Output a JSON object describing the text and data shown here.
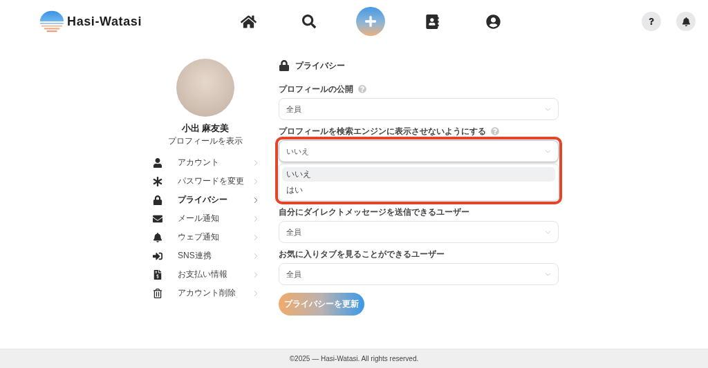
{
  "header": {
    "brand": "Hasi-Watasi"
  },
  "profile": {
    "name": "小出 麻友美",
    "link": "プロフィールを表示"
  },
  "sidebar": {
    "items": [
      {
        "label": "アカウント",
        "selected": false
      },
      {
        "label": "パスワードを変更",
        "selected": false
      },
      {
        "label": "プライバシー",
        "selected": true
      },
      {
        "label": "メール通知",
        "selected": false
      },
      {
        "label": "ウェブ通知",
        "selected": false
      },
      {
        "label": "SNS連携",
        "selected": false
      },
      {
        "label": "お支払い情報",
        "selected": false
      },
      {
        "label": "アカウント削除",
        "selected": false
      }
    ]
  },
  "section": {
    "title": "プライバシー"
  },
  "fields": [
    {
      "label": "プロフィールの公開",
      "help": true,
      "value": "全員",
      "expanded": false,
      "highlighted": false
    },
    {
      "label": "プロフィールを検索エンジンに表示させないようにする",
      "help": true,
      "value": "いいえ",
      "expanded": true,
      "highlighted": true,
      "options": [
        {
          "label": "いいえ",
          "selected": true
        },
        {
          "label": "はい",
          "selected": false
        }
      ]
    },
    {
      "label": "自分にダイレクトメッセージを送信できるユーザー",
      "help": false,
      "value": "全員",
      "expanded": false,
      "highlighted": false
    },
    {
      "label": "お気に入りタブを見ることができるユーザー",
      "help": false,
      "value": "全員",
      "expanded": false,
      "highlighted": false
    }
  ],
  "submit_button": {
    "label": "プライバシーを更新"
  },
  "footer": {
    "text": "©2025 — Hasi-Watasi. All rights reserved."
  }
}
